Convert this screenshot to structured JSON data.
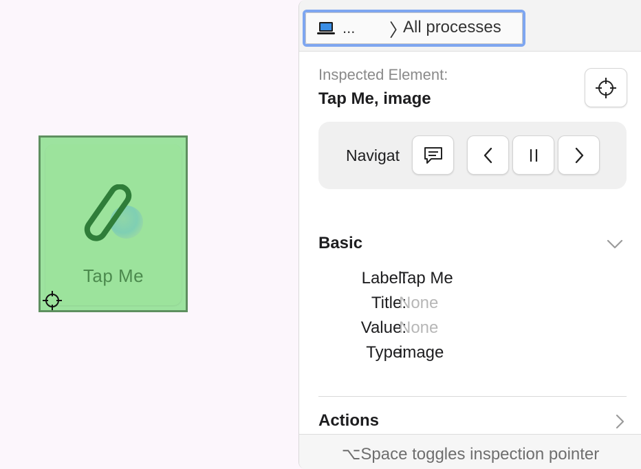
{
  "canvas": {
    "app_tile_label": "Tap Me",
    "icon": "paperclip-app-icon",
    "pointer_icon": "crosshair-icon",
    "colors": {
      "highlight": "#9de39f",
      "highlight_border": "#5e8f5f",
      "label": "#4c8a4e"
    }
  },
  "inspector": {
    "process": {
      "device_icon": "laptop-icon",
      "ellipsis": "...",
      "separator": "〉",
      "label": "All processes"
    },
    "inspected": {
      "caption": "Inspected Element:",
      "value": "Tap Me, image",
      "target_button_icon": "crosshair-icon"
    },
    "navigation": {
      "label": "Navigat",
      "buttons": [
        {
          "icon": "speech-bubble-icon"
        },
        {
          "icon": "chevron-left-icon"
        },
        {
          "icon": "pause-icon"
        },
        {
          "icon": "chevron-right-icon"
        }
      ]
    },
    "basic": {
      "title": "Basic",
      "toggle_icon": "chevron-down-icon",
      "properties": [
        {
          "key": "Label:",
          "value": "Tap Me",
          "muted": false
        },
        {
          "key": "Title:",
          "value": "None",
          "muted": true
        },
        {
          "key": "Value:",
          "value": "None",
          "muted": true
        },
        {
          "key": "Type:",
          "value": "image",
          "muted": false
        }
      ]
    },
    "actions": {
      "title": "Actions",
      "toggle_icon": "chevron-right-icon"
    },
    "footer": "⌥Space toggles inspection pointer",
    "colors": {
      "selector_border": "#7ea6f0",
      "muted_text": "#b7b7b7"
    }
  }
}
